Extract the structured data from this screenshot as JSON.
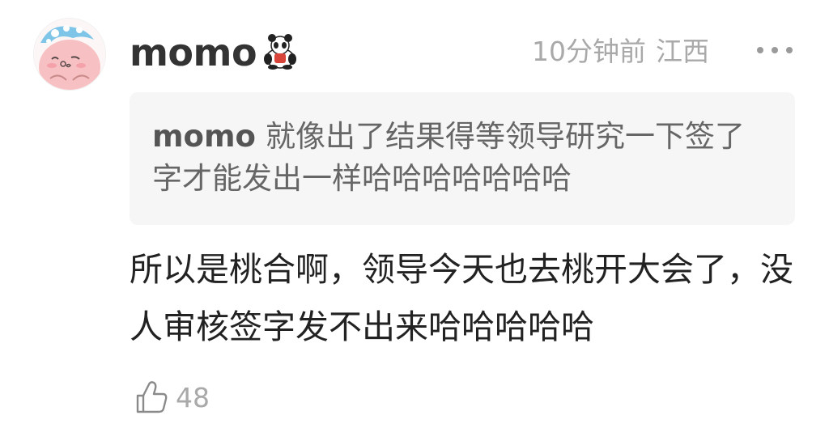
{
  "comment": {
    "username": "momo",
    "avatar_icon": "pink-cartoon-avatar-icon",
    "badge_icon": "panda-badge-icon",
    "time": "10分钟前",
    "location": "江西",
    "more_icon": "more-dots-icon",
    "quote": {
      "name": "momo",
      "text": "就像出了结果得等领导研究一下签了字才能发出一样哈哈哈哈哈哈哈"
    },
    "body": "所以是桃合啊，领导今天也去桃开大会了，没人审核签字发不出来哈哈哈哈哈",
    "like_icon": "thumbs-up-icon",
    "likes": "48"
  },
  "colors": {
    "text_primary": "#222222",
    "text_muted": "#a9a9a9",
    "quote_bg": "#f6f6f6",
    "avatar_pink": "#f5b8b8"
  }
}
